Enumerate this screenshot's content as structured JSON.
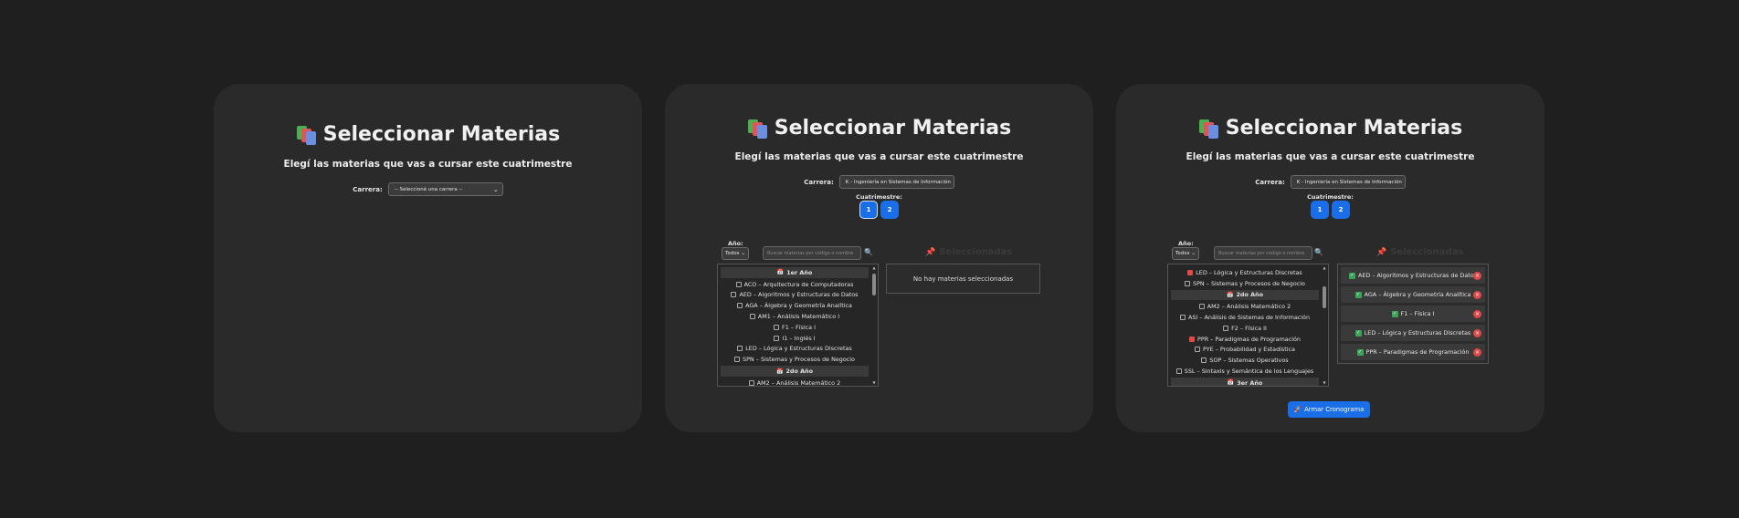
{
  "screens": [
    {
      "title": "Seleccionar Materias",
      "subtitle": "Elegí las materias que vas a cursar este cuatrimestre",
      "carrera_label": "Carrera:",
      "carrera_value": "-- Seleccioná una carrera --"
    },
    {
      "title": "Seleccionar Materias",
      "subtitle": "Elegí las materias que vas a cursar este cuatrimestre",
      "carrera_label": "Carrera:",
      "carrera_value": "K - Ingeniería en Sistemas de Información",
      "cuatrimestre_label": "Cuatrimestre:",
      "cuatrimestre_options": [
        "1",
        "2"
      ],
      "anio_label": "Año:",
      "anio_value": "Todos",
      "search_placeholder": "Buscar materias por código o nombre",
      "list": [
        {
          "type": "header",
          "text": "1er Año"
        },
        {
          "type": "item",
          "text": "ACO – Arquitectura de Computadoras",
          "checked": false
        },
        {
          "type": "item",
          "text": "AED – Algoritmos y Estructuras de Datos",
          "checked": false
        },
        {
          "type": "item",
          "text": "AGA – Álgebra y Geometría Analítica",
          "checked": false
        },
        {
          "type": "item",
          "text": "AM1 – Análisis Matemático I",
          "checked": false
        },
        {
          "type": "item",
          "text": "F1 – Física I",
          "checked": false
        },
        {
          "type": "item",
          "text": "I1 – Inglés I",
          "checked": false
        },
        {
          "type": "item",
          "text": "LED – Lógica y Estructuras Discretas",
          "checked": false
        },
        {
          "type": "item",
          "text": "SPN – Sistemas y Procesos de Negocio",
          "checked": false
        },
        {
          "type": "header",
          "text": "2do Año"
        },
        {
          "type": "item",
          "text": "AM2 – Análisis Matemático 2",
          "checked": false
        }
      ],
      "selected_title": "Seleccionadas",
      "empty_text": "No hay materias seleccionadas"
    },
    {
      "title": "Seleccionar Materias",
      "subtitle": "Elegí las materias que vas a cursar este cuatrimestre",
      "carrera_label": "Carrera:",
      "carrera_value": "K - Ingeniería en Sistemas de Información",
      "cuatrimestre_label": "Cuatrimestre:",
      "cuatrimestre_options": [
        "1",
        "2"
      ],
      "anio_label": "Año:",
      "anio_value": "Todos",
      "search_placeholder": "Buscar materias por código o nombre",
      "list": [
        {
          "type": "item",
          "text": "LED – Lógica y Estructuras Discretas",
          "checked": true
        },
        {
          "type": "item",
          "text": "SPN – Sistemas y Procesos de Negocio",
          "checked": false
        },
        {
          "type": "header",
          "text": "2do Año"
        },
        {
          "type": "item",
          "text": "AM2 – Análisis Matemático 2",
          "checked": false
        },
        {
          "type": "item",
          "text": "ASI – Análisis de Sistemas de Información",
          "checked": false
        },
        {
          "type": "item",
          "text": "F2 – Física II",
          "checked": false
        },
        {
          "type": "item",
          "text": "PPR – Paradigmas de Programación",
          "checked": true
        },
        {
          "type": "item",
          "text": "PYE – Probabilidad y Estadística",
          "checked": false
        },
        {
          "type": "item",
          "text": "SOP – Sistemas Operativos",
          "checked": false
        },
        {
          "type": "item",
          "text": "SSL – Sintaxis y Semántica de los Lenguajes",
          "checked": false
        },
        {
          "type": "header",
          "text": "3er Año"
        }
      ],
      "selected_title": "Seleccionadas",
      "selected": [
        "AED – Algoritmos y Estructuras de Datos",
        "AGA – Álgebra y Geometría Analítica",
        "F1 – Física I",
        "LED – Lógica y Estructuras Discretas",
        "PPR – Paradigmas de Programación"
      ],
      "action_label": "Armar Cronograma"
    }
  ],
  "icons": {
    "title": "books-icon",
    "year_header": "calendar-icon",
    "search": "magnifier-icon",
    "selected": "pushpin-icon",
    "chip_check": "check-icon",
    "chip_remove": "close-icon",
    "action": "rocket-icon"
  },
  "colors": {
    "background": "#1f1f1f",
    "panel": "#2a2a2a",
    "accent": "#1a6fe8",
    "remove": "#e04848",
    "check": "#3aa55a"
  }
}
